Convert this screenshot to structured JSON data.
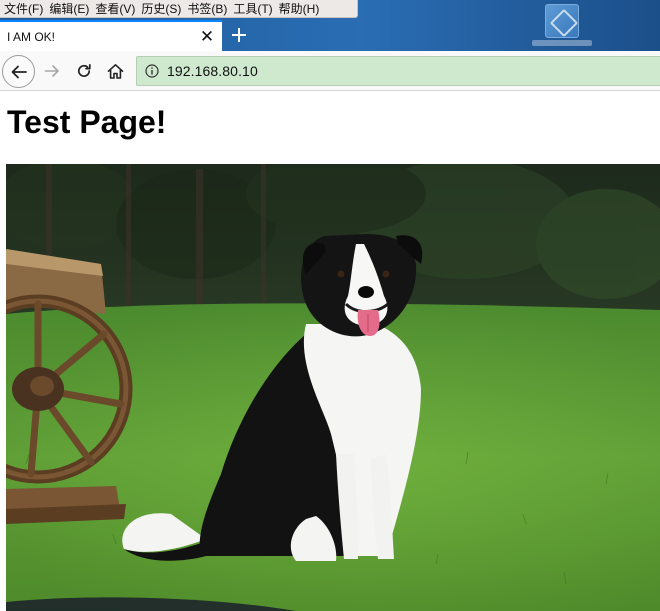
{
  "menubar": {
    "items": [
      "文件(F)",
      "编辑(E)",
      "查看(V)",
      "历史(S)",
      "书签(B)",
      "工具(T)",
      "帮助(H)"
    ]
  },
  "tab": {
    "title": "I AM OK!",
    "close_glyph": "✕"
  },
  "toolbar": {
    "url": "192.168.80.10"
  },
  "page": {
    "heading": "Test Page!",
    "image_subject": "border-collie-on-grass"
  },
  "icons": {
    "back": "back-arrow-icon",
    "forward": "forward-arrow-icon",
    "reload": "reload-icon",
    "home": "home-icon",
    "info": "info-icon",
    "new_tab": "plus-icon",
    "close": "close-icon"
  },
  "colors": {
    "tab_accent": "#0a84ff",
    "urlbar_bg": "#cfe9cf",
    "desktop_blue": "#2a6db3"
  }
}
